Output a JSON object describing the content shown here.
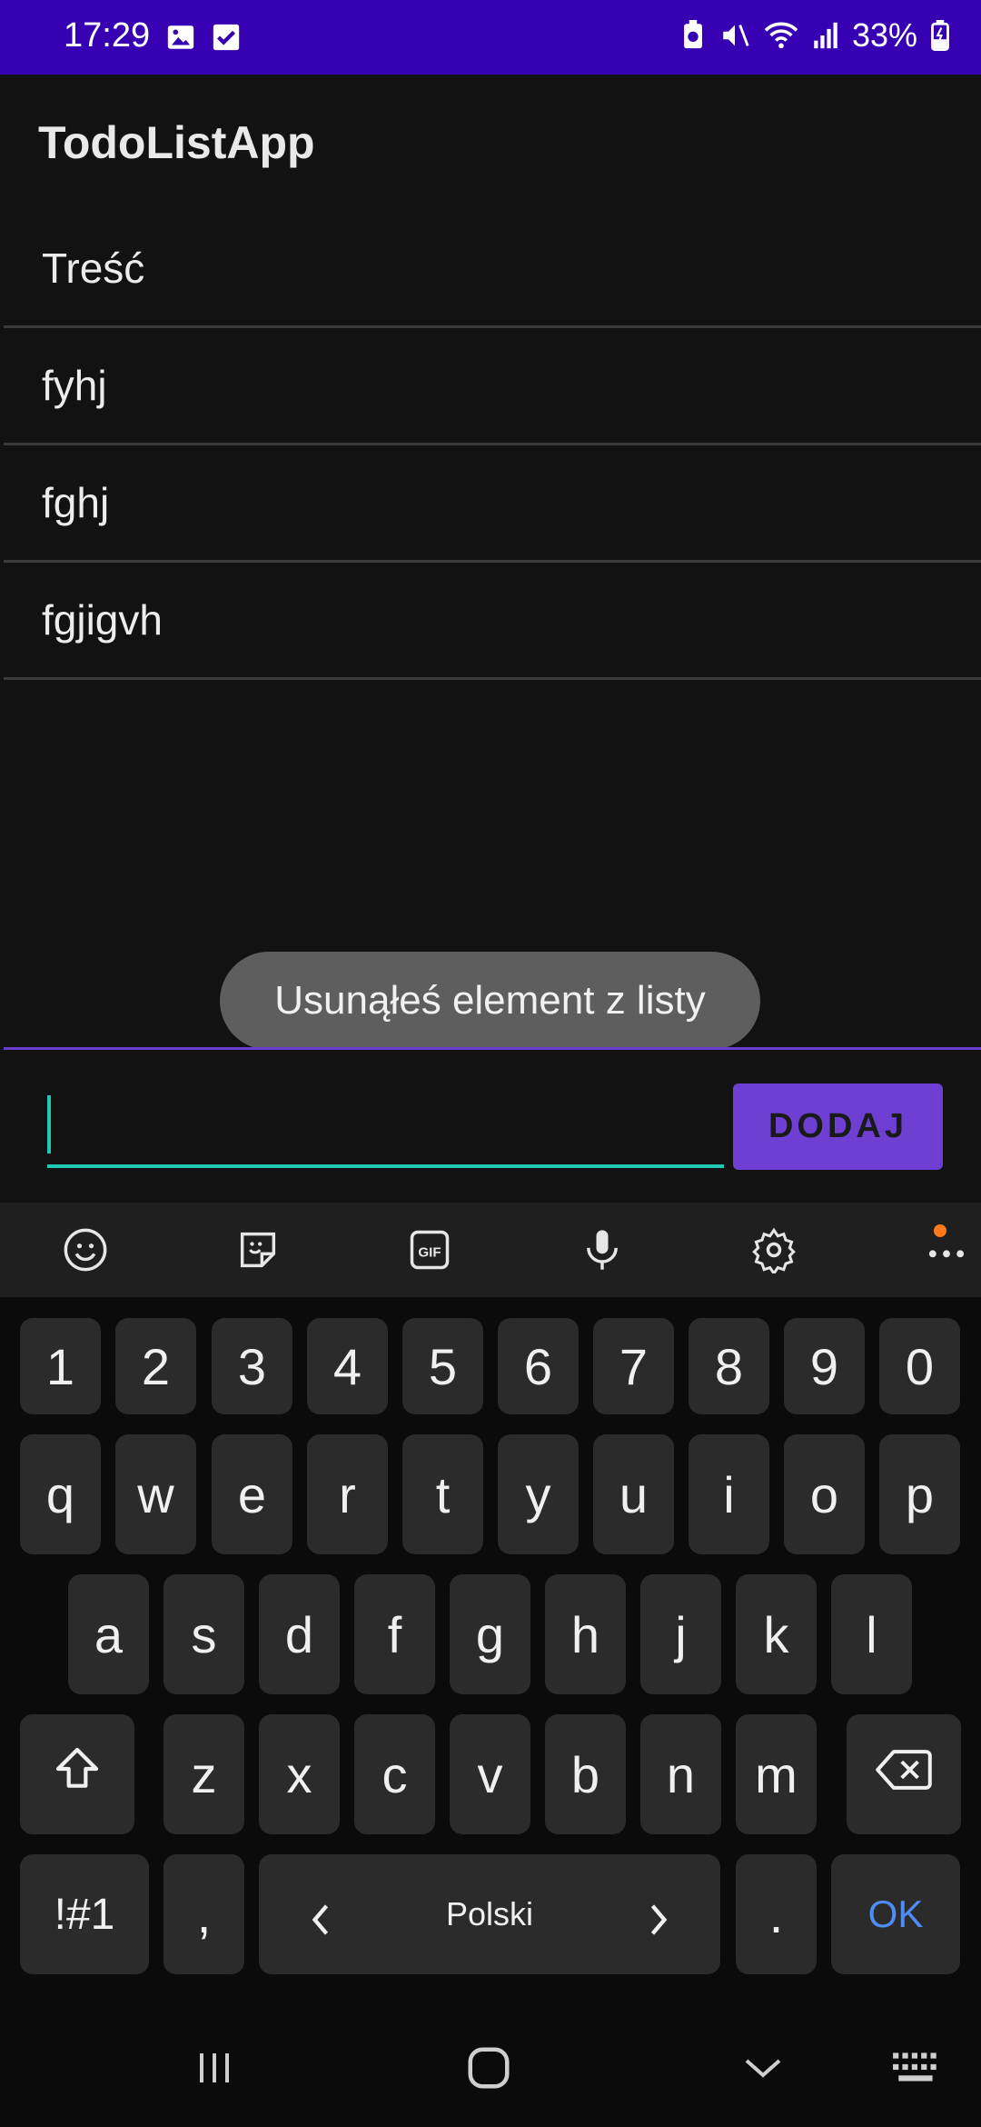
{
  "status_bar": {
    "time": "17:29",
    "battery": "33%",
    "background": "#3700b3"
  },
  "app": {
    "title": "TodoListApp"
  },
  "list": {
    "items": [
      "Treść",
      "fyhj",
      "fghj",
      "fgjigvh"
    ]
  },
  "toast": {
    "message": "Usunąłeś element z listy"
  },
  "input": {
    "value": "",
    "placeholder": "",
    "accent": "#1fc9b3"
  },
  "add_button": {
    "label": "DODAJ",
    "color": "#6f3fd3"
  },
  "keyboard": {
    "toolbar_icons": [
      "emoji-icon",
      "sticker-icon",
      "gif-icon",
      "microphone-icon",
      "settings-icon",
      "more-icon"
    ],
    "rows": {
      "numbers": [
        "1",
        "2",
        "3",
        "4",
        "5",
        "6",
        "7",
        "8",
        "9",
        "0"
      ],
      "row1": [
        "q",
        "w",
        "e",
        "r",
        "t",
        "y",
        "u",
        "i",
        "o",
        "p"
      ],
      "row2": [
        "a",
        "s",
        "d",
        "f",
        "g",
        "h",
        "j",
        "k",
        "l"
      ],
      "row3": [
        "z",
        "x",
        "c",
        "v",
        "b",
        "n",
        "m"
      ]
    },
    "symbols_label": "!#1",
    "comma_label": ",",
    "language_label": "Polski",
    "period_label": ".",
    "ok_label": "OK"
  },
  "navigation": {
    "buttons": [
      "recent-apps-icon",
      "home-icon",
      "back-icon",
      "keyboard-switch-icon"
    ]
  }
}
